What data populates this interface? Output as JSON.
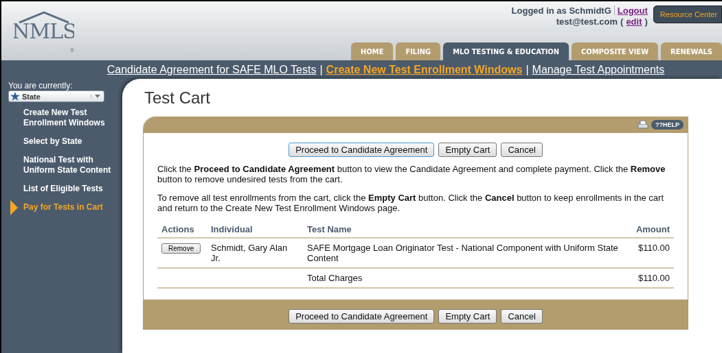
{
  "header": {
    "logo": "NMLS",
    "logo_mark": "®",
    "user_prefix": "Logged in as SchmidtG",
    "logout": "Logout",
    "email": "test@test.com",
    "paren_open": "(",
    "edit": "edit",
    "paren_close": ")",
    "resource_center": "Resource Center"
  },
  "tabs": [
    {
      "label": "HOME",
      "selected": false
    },
    {
      "label": "FILING",
      "selected": false
    },
    {
      "label": "MLO TESTING & EDUCATION",
      "selected": true
    },
    {
      "label": "COMPOSITE VIEW",
      "selected": false
    },
    {
      "label": "RENEWALS",
      "selected": false
    }
  ],
  "subnav_separator": "|",
  "subnav": [
    {
      "label": "Candidate Agreement for SAFE MLO Tests",
      "selected": false
    },
    {
      "label": "Create New Test Enrollment Windows",
      "selected": true
    },
    {
      "label": "Manage Test Appointments",
      "selected": false
    }
  ],
  "sidebar": {
    "caption": "You are currently:",
    "role": "State",
    "items": [
      {
        "label": "Create New Test Enrollment Windows",
        "selected": false
      },
      {
        "label": "Select by State",
        "selected": false
      },
      {
        "label": "National Test with Uniform State Content",
        "selected": false
      },
      {
        "label": "List of Eligible Tests",
        "selected": false
      },
      {
        "label": "Pay for Tests in Cart",
        "selected": true
      }
    ]
  },
  "page_title": "Test Cart",
  "help": "??HELP",
  "buttons": [
    "Proceed to Candidate Agreement",
    "Empty Cart",
    "Cancel"
  ],
  "paragraphs": [
    "Click the **Proceed to Candidate Agreement** button to view the Candidate Agreement and complete payment. Click the **Remove** button to remove undesired tests from the cart.",
    "To remove all test enrollments from the cart, click the **Empty Cart** button. Click the **Cancel** button to keep enrollments in the cart and return to the Create New Test Enrollment Windows page."
  ],
  "table": {
    "columns": [
      "Actions",
      "Individual",
      "Test Name",
      "Amount"
    ],
    "rows": [
      {
        "action": "Remove",
        "individual": "Schmidt, Gary Alan Jr.",
        "test_name": "SAFE Mortgage Loan Originator Test - National Component with Uniform State Content",
        "amount": "$110.00"
      }
    ],
    "total_label": "Total Charges",
    "total": "$110.00"
  },
  "footer_buttons": [
    "Proceed to Candidate Agreement",
    "Empty Cart",
    "Cancel"
  ]
}
